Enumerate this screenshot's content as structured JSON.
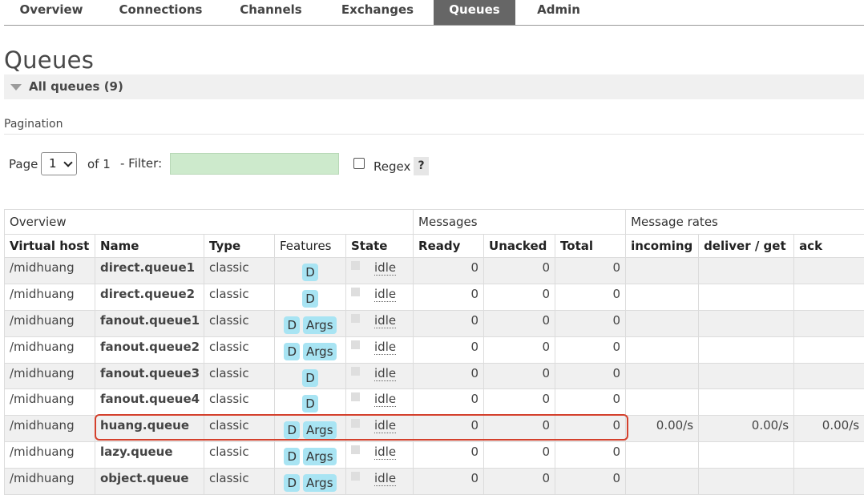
{
  "nav": {
    "tabs": [
      {
        "label": "Overview",
        "active": false
      },
      {
        "label": "Connections",
        "active": false
      },
      {
        "label": "Channels",
        "active": false
      },
      {
        "label": "Exchanges",
        "active": false
      },
      {
        "label": "Queues",
        "active": true
      },
      {
        "label": "Admin",
        "active": false
      }
    ]
  },
  "page": {
    "title": "Queues",
    "section_label": "All queues (9)",
    "pagination_label": "Pagination"
  },
  "controls": {
    "page_label": "Page",
    "page_value": "1",
    "of_label": "of 1",
    "filter_label": "- Filter:",
    "filter_value": "",
    "regex_label": "Regex",
    "regex_checked": false,
    "help_label": "?"
  },
  "table": {
    "groups": [
      "Overview",
      "Messages",
      "Message rates"
    ],
    "columns": [
      "Virtual host",
      "Name",
      "Type",
      "Features",
      "State",
      "Ready",
      "Unacked",
      "Total",
      "incoming",
      "deliver / get",
      "ack"
    ],
    "rows": [
      {
        "vhost": "/midhuang",
        "name": "direct.queue1",
        "type": "classic",
        "features": [
          "D"
        ],
        "state": "idle",
        "ready": "0",
        "unacked": "0",
        "total": "0",
        "incoming": "",
        "deliver": "",
        "ack": ""
      },
      {
        "vhost": "/midhuang",
        "name": "direct.queue2",
        "type": "classic",
        "features": [
          "D"
        ],
        "state": "idle",
        "ready": "0",
        "unacked": "0",
        "total": "0",
        "incoming": "",
        "deliver": "",
        "ack": ""
      },
      {
        "vhost": "/midhuang",
        "name": "fanout.queue1",
        "type": "classic",
        "features": [
          "D",
          "Args"
        ],
        "state": "idle",
        "ready": "0",
        "unacked": "0",
        "total": "0",
        "incoming": "",
        "deliver": "",
        "ack": ""
      },
      {
        "vhost": "/midhuang",
        "name": "fanout.queue2",
        "type": "classic",
        "features": [
          "D",
          "Args"
        ],
        "state": "idle",
        "ready": "0",
        "unacked": "0",
        "total": "0",
        "incoming": "",
        "deliver": "",
        "ack": ""
      },
      {
        "vhost": "/midhuang",
        "name": "fanout.queue3",
        "type": "classic",
        "features": [
          "D"
        ],
        "state": "idle",
        "ready": "0",
        "unacked": "0",
        "total": "0",
        "incoming": "",
        "deliver": "",
        "ack": ""
      },
      {
        "vhost": "/midhuang",
        "name": "fanout.queue4",
        "type": "classic",
        "features": [
          "D"
        ],
        "state": "idle",
        "ready": "0",
        "unacked": "0",
        "total": "0",
        "incoming": "",
        "deliver": "",
        "ack": ""
      },
      {
        "vhost": "/midhuang",
        "name": "huang.queue",
        "type": "classic",
        "features": [
          "D",
          "Args"
        ],
        "state": "idle",
        "ready": "0",
        "unacked": "0",
        "total": "0",
        "incoming": "0.00/s",
        "deliver": "0.00/s",
        "ack": "0.00/s",
        "highlighted": true
      },
      {
        "vhost": "/midhuang",
        "name": "lazy.queue",
        "type": "classic",
        "features": [
          "D",
          "Args"
        ],
        "state": "idle",
        "ready": "0",
        "unacked": "0",
        "total": "0",
        "incoming": "",
        "deliver": "",
        "ack": ""
      },
      {
        "vhost": "/midhuang",
        "name": "object.queue",
        "type": "classic",
        "features": [
          "D",
          "Args"
        ],
        "state": "idle",
        "ready": "0",
        "unacked": "0",
        "total": "0",
        "incoming": "",
        "deliver": "",
        "ack": ""
      }
    ]
  },
  "colors": {
    "active_tab_bg": "#666666",
    "badge_bg": "#a8e4f3",
    "filter_bg": "#cdeacc",
    "highlight_border": "#d4402c",
    "row_stripe": "#f0f0f0"
  }
}
